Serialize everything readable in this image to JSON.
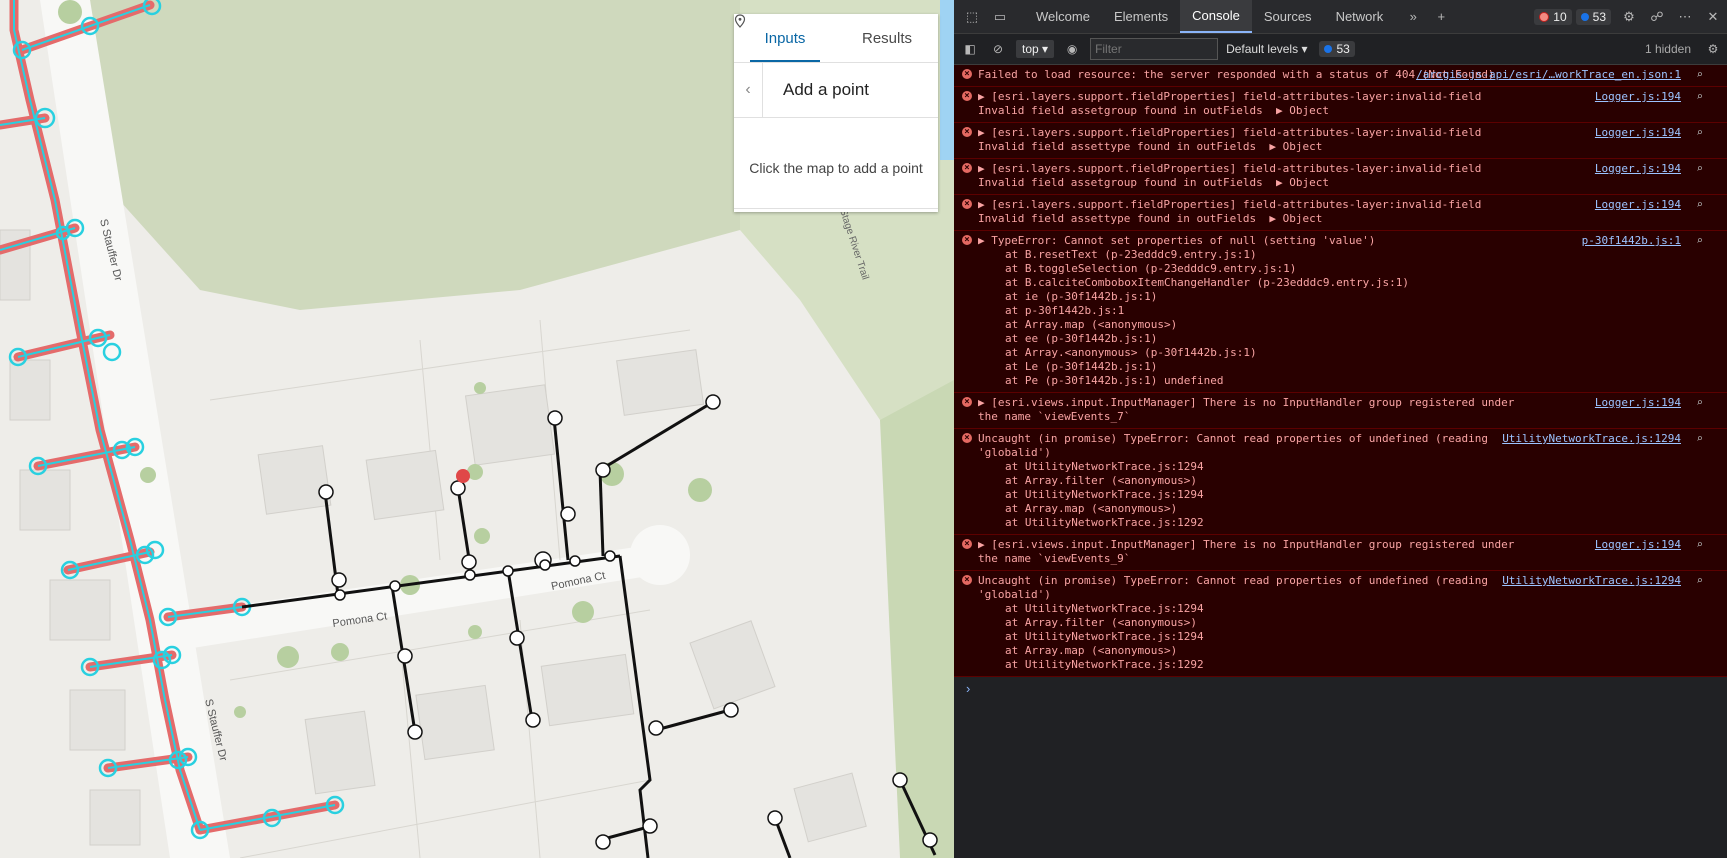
{
  "map": {
    "street_labels": [
      "S Stauffer Dr",
      "S Stauffer Dr",
      "Pomona Ct",
      "Pomona Ct",
      "Stage River Trail"
    ],
    "colors": {
      "trace": "#e46b6b",
      "selection": "#29d0e0",
      "line": "#111111",
      "land": "#eeede9",
      "park": "#c9d8b4",
      "water": "#9fd3f3"
    }
  },
  "panel": {
    "tabs": [
      "Inputs",
      "Results"
    ],
    "active_tab": "Inputs",
    "title": "Add a point",
    "hint": "Click the map to add a point"
  },
  "devtools": {
    "tabs": [
      "Welcome",
      "Elements",
      "Console",
      "Sources",
      "Network"
    ],
    "active_tab": "Console",
    "error_count": "10",
    "info_count": "53",
    "context": "top",
    "filter_placeholder": "Filter",
    "levels": "Default levels",
    "levels_count": "53",
    "hidden": "1 hidden",
    "messages": [
      {
        "text": "Failed to load resource: the server responded with a status of 404 (Not Found)",
        "src": "/arcgis-js-api/esri/…workTrace_en.json:1",
        "stack": []
      },
      {
        "text": "▶ [esri.layers.support.fieldProperties] field-attributes-layer:invalid-field Invalid field assetgroup found in outFields  ▶ Object",
        "src": "Logger.js:194",
        "stack": []
      },
      {
        "text": "▶ [esri.layers.support.fieldProperties] field-attributes-layer:invalid-field Invalid field assettype found in outFields  ▶ Object",
        "src": "Logger.js:194",
        "stack": []
      },
      {
        "text": "▶ [esri.layers.support.fieldProperties] field-attributes-layer:invalid-field Invalid field assetgroup found in outFields  ▶ Object",
        "src": "Logger.js:194",
        "stack": []
      },
      {
        "text": "▶ [esri.layers.support.fieldProperties] field-attributes-layer:invalid-field Invalid field assettype found in outFields  ▶ Object",
        "src": "Logger.js:194",
        "stack": []
      },
      {
        "text": "▶ TypeError: Cannot set properties of null (setting 'value')",
        "src": "p-30f1442b.js:1",
        "stack": [
          "at B.resetText (p-23edddc9.entry.js:1)",
          "at B.toggleSelection (p-23edddc9.entry.js:1)",
          "at B.calciteComboboxItemChangeHandler (p-23edddc9.entry.js:1)",
          "at ie (p-30f1442b.js:1)",
          "at p-30f1442b.js:1",
          "at Array.map (<anonymous>)",
          "at ee (p-30f1442b.js:1)",
          "at Array.<anonymous> (p-30f1442b.js:1)",
          "at Le (p-30f1442b.js:1)",
          "at Pe (p-30f1442b.js:1) undefined"
        ]
      },
      {
        "text": "▶ [esri.views.input.InputManager] There is no InputHandler group registered under the name `viewEvents_7`",
        "src": "Logger.js:194",
        "stack": []
      },
      {
        "text": "Uncaught (in promise) TypeError: Cannot read properties of undefined (reading 'globalid')",
        "src": "UtilityNetworkTrace.js:1294",
        "stack": [
          "at UtilityNetworkTrace.js:1294",
          "at Array.filter (<anonymous>)",
          "at UtilityNetworkTrace.js:1294",
          "at Array.map (<anonymous>)",
          "at UtilityNetworkTrace.js:1292"
        ]
      },
      {
        "text": "▶ [esri.views.input.InputManager] There is no InputHandler group registered under the name `viewEvents_9`",
        "src": "Logger.js:194",
        "stack": []
      },
      {
        "text": "Uncaught (in promise) TypeError: Cannot read properties of undefined (reading 'globalid')",
        "src": "UtilityNetworkTrace.js:1294",
        "stack": [
          "at UtilityNetworkTrace.js:1294",
          "at Array.filter (<anonymous>)",
          "at UtilityNetworkTrace.js:1294",
          "at Array.map (<anonymous>)",
          "at UtilityNetworkTrace.js:1292"
        ]
      }
    ],
    "prompt": "›"
  }
}
